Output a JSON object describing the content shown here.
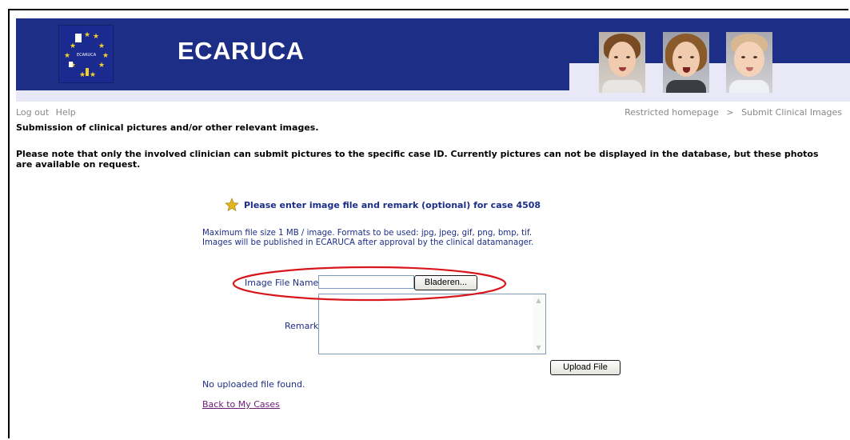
{
  "header": {
    "brand": "ECARUCA",
    "logo_text": "ECARUCA"
  },
  "nav": {
    "logout": "Log out",
    "help": "Help",
    "breadcrumb": [
      "Restricted homepage",
      "Submit Clinical Images"
    ],
    "separator": ">"
  },
  "page": {
    "heading": "Submission of clinical pictures and/or other relevant images.",
    "note": "Please note that only the involved clinician can submit pictures to the specific case ID. Currently pictures can not be displayed in the database, but these photos are available on request."
  },
  "form": {
    "title": "Please enter image file and remark (optional) for case 4508",
    "info_line1": "Maximum file size 1 MB / image. Formats to be used: jpg, jpeg, gif, png, bmp, tif.",
    "info_line2": "Images will be published in ECARUCA after approval by the clinical datamanager.",
    "file_label": "Image File Name",
    "file_value": "",
    "browse_button": "Bladeren...",
    "remark_label": "Remark",
    "remark_value": "",
    "upload_button": "Upload File",
    "status": "No uploaded file found.",
    "back_link": "Back to My Cases"
  },
  "colors": {
    "banner": "#1d2e86",
    "text_blue": "#1d2e86",
    "annotation": "#d9161c",
    "star": "#e2b41d"
  },
  "icons": [
    "star-icon",
    "eu-logo"
  ]
}
